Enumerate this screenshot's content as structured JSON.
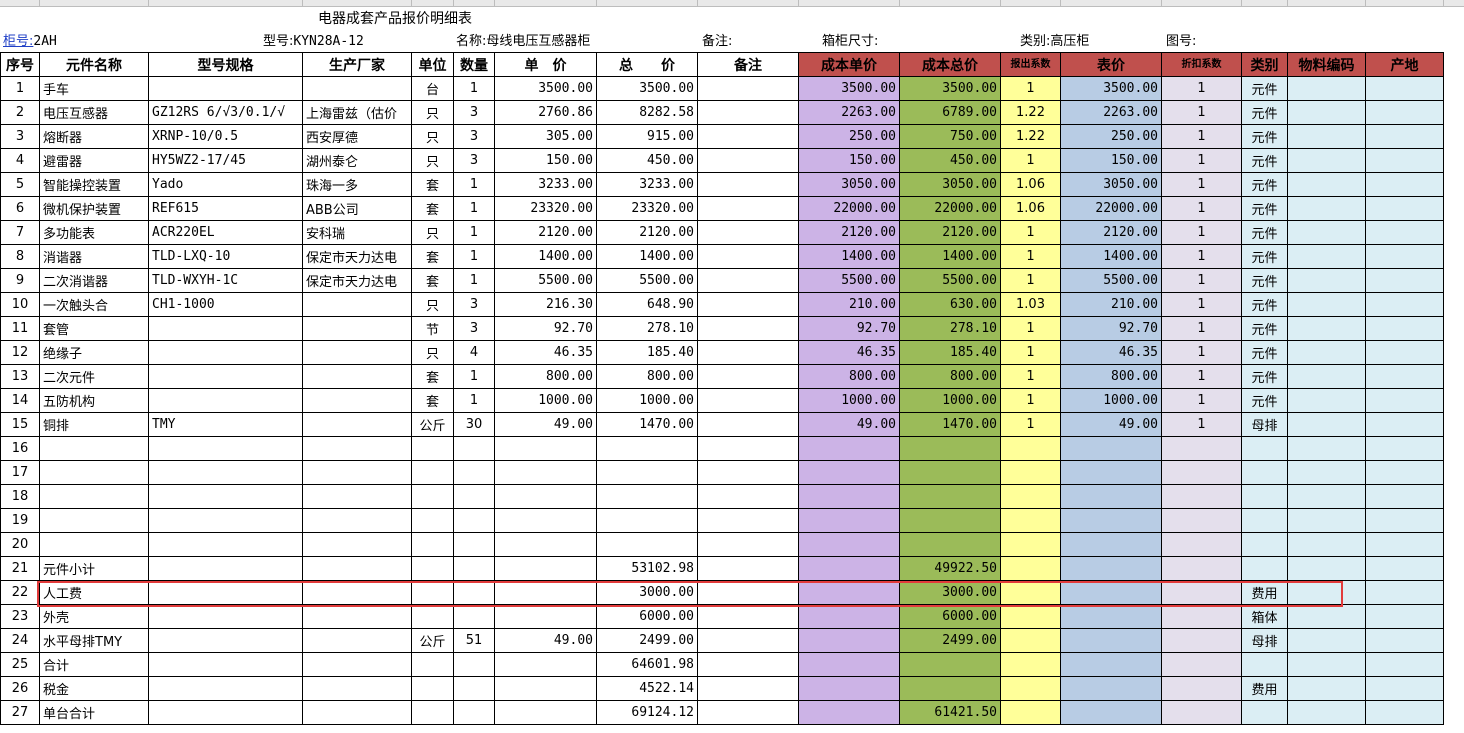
{
  "sheet": {
    "title": "电器成套产品报价明细表",
    "cabinet_no_label": "柜号:",
    "cabinet_no_value": "2AH",
    "model_label": "型号:",
    "model_value": "KYN28A-12",
    "name_label": "名称:",
    "name_value": "母线电压互感器柜",
    "note_label": "备注:",
    "box_size_label": "箱柜尺寸:",
    "category_label": "类别:",
    "category_value": "高压柜",
    "drawing_label": "图号:"
  },
  "columns": [
    "序号",
    "元件名称",
    "型号规格",
    "生产厂家",
    "单位",
    "数量",
    "单　价",
    "总　　价",
    "备注",
    "成本单价",
    "成本总价",
    "报出系数",
    "表价",
    "折扣系数",
    "类别",
    "物料编码",
    "产地"
  ],
  "rows": [
    {
      "no": "1",
      "name": "手车",
      "model": "",
      "maker": "",
      "unit": "台",
      "qty": "1",
      "price": "3500.00",
      "total": "3500.00",
      "cost_unit": "3500.00",
      "cost_total": "3500.00",
      "coef": "1",
      "list": "3500.00",
      "disc": "1",
      "type": "元件"
    },
    {
      "no": "2",
      "name": "电压互感器",
      "model": "GZ12RS  6/√3/0.1/√",
      "maker": "上海雷兹（估价",
      "unit": "只",
      "qty": "3",
      "price": "2760.86",
      "total": "8282.58",
      "cost_unit": "2263.00",
      "cost_total": "6789.00",
      "coef": "1.22",
      "list": "2263.00",
      "disc": "1",
      "type": "元件"
    },
    {
      "no": "3",
      "name": "熔断器",
      "model": "XRNP-10/0.5",
      "maker": "西安厚德",
      "unit": "只",
      "qty": "3",
      "price": "305.00",
      "total": "915.00",
      "cost_unit": "250.00",
      "cost_total": "750.00",
      "coef": "1.22",
      "list": "250.00",
      "disc": "1",
      "type": "元件"
    },
    {
      "no": "4",
      "name": "避雷器",
      "model": "HY5WZ2-17/45",
      "maker": "湖州泰仑",
      "unit": "只",
      "qty": "3",
      "price": "150.00",
      "total": "450.00",
      "cost_unit": "150.00",
      "cost_total": "450.00",
      "coef": "1",
      "list": "150.00",
      "disc": "1",
      "type": "元件"
    },
    {
      "no": "5",
      "name": "智能操控装置",
      "model": "Yado",
      "maker": "珠海一多",
      "unit": "套",
      "qty": "1",
      "price": "3233.00",
      "total": "3233.00",
      "cost_unit": "3050.00",
      "cost_total": "3050.00",
      "coef": "1.06",
      "list": "3050.00",
      "disc": "1",
      "type": "元件"
    },
    {
      "no": "6",
      "name": "微机保护装置",
      "model": "REF615",
      "maker": "ABB公司",
      "unit": "套",
      "qty": "1",
      "price": "23320.00",
      "total": "23320.00",
      "cost_unit": "22000.00",
      "cost_total": "22000.00",
      "coef": "1.06",
      "list": "22000.00",
      "disc": "1",
      "type": "元件"
    },
    {
      "no": "7",
      "name": "多功能表",
      "model": "ACR220EL",
      "maker": "安科瑞",
      "unit": "只",
      "qty": "1",
      "price": "2120.00",
      "total": "2120.00",
      "cost_unit": "2120.00",
      "cost_total": "2120.00",
      "coef": "1",
      "list": "2120.00",
      "disc": "1",
      "type": "元件"
    },
    {
      "no": "8",
      "name": "消谐器",
      "model": "TLD-LXQ-10",
      "maker": "保定市天力达电",
      "unit": "套",
      "qty": "1",
      "price": "1400.00",
      "total": "1400.00",
      "cost_unit": "1400.00",
      "cost_total": "1400.00",
      "coef": "1",
      "list": "1400.00",
      "disc": "1",
      "type": "元件"
    },
    {
      "no": "9",
      "name": "二次消谐器",
      "model": "TLD-WXYH-1C",
      "maker": "保定市天力达电",
      "unit": "套",
      "qty": "1",
      "price": "5500.00",
      "total": "5500.00",
      "cost_unit": "5500.00",
      "cost_total": "5500.00",
      "coef": "1",
      "list": "5500.00",
      "disc": "1",
      "type": "元件"
    },
    {
      "no": "10",
      "name": "一次触头合",
      "model": "CH1-1000",
      "maker": "",
      "unit": "只",
      "qty": "3",
      "price": "216.30",
      "total": "648.90",
      "cost_unit": "210.00",
      "cost_total": "630.00",
      "coef": "1.03",
      "list": "210.00",
      "disc": "1",
      "type": "元件"
    },
    {
      "no": "11",
      "name": "套管",
      "model": "",
      "maker": "",
      "unit": "节",
      "qty": "3",
      "price": "92.70",
      "total": "278.10",
      "cost_unit": "92.70",
      "cost_total": "278.10",
      "coef": "1",
      "list": "92.70",
      "disc": "1",
      "type": "元件"
    },
    {
      "no": "12",
      "name": "绝缘子",
      "model": "",
      "maker": "",
      "unit": "只",
      "qty": "4",
      "price": "46.35",
      "total": "185.40",
      "cost_unit": "46.35",
      "cost_total": "185.40",
      "coef": "1",
      "list": "46.35",
      "disc": "1",
      "type": "元件"
    },
    {
      "no": "13",
      "name": "二次元件",
      "model": "",
      "maker": "",
      "unit": "套",
      "qty": "1",
      "price": "800.00",
      "total": "800.00",
      "cost_unit": "800.00",
      "cost_total": "800.00",
      "coef": "1",
      "list": "800.00",
      "disc": "1",
      "type": "元件"
    },
    {
      "no": "14",
      "name": "五防机构",
      "model": "",
      "maker": "",
      "unit": "套",
      "qty": "1",
      "price": "1000.00",
      "total": "1000.00",
      "cost_unit": "1000.00",
      "cost_total": "1000.00",
      "coef": "1",
      "list": "1000.00",
      "disc": "1",
      "type": "元件"
    },
    {
      "no": "15",
      "name": "铜排",
      "model": "TMY",
      "maker": "",
      "unit": "公斤",
      "qty": "30",
      "price": "49.00",
      "total": "1470.00",
      "cost_unit": "49.00",
      "cost_total": "1470.00",
      "coef": "1",
      "list": "49.00",
      "disc": "1",
      "type": "母排"
    },
    {
      "no": "16"
    },
    {
      "no": "17"
    },
    {
      "no": "18"
    },
    {
      "no": "19"
    },
    {
      "no": "20"
    },
    {
      "no": "21",
      "name": "元件小计",
      "total": "53102.98",
      "cost_total": "49922.50"
    },
    {
      "no": "22",
      "name": "人工费",
      "total": "3000.00",
      "cost_total": "3000.00",
      "type": "费用"
    },
    {
      "no": "23",
      "name": "外壳",
      "total": "6000.00",
      "cost_total": "6000.00",
      "type": "箱体"
    },
    {
      "no": "24",
      "name": "水平母排TMY",
      "unit": "公斤",
      "qty": "51",
      "price": "49.00",
      "total": "2499.00",
      "cost_total": "2499.00",
      "type": "母排"
    },
    {
      "no": "25",
      "name": "合计",
      "total": "64601.98"
    },
    {
      "no": "26",
      "name": "税金",
      "total": "4522.14",
      "type": "费用"
    },
    {
      "no": "27",
      "name": "单台合计",
      "total": "69124.12",
      "cost_total": "61421.50"
    }
  ]
}
